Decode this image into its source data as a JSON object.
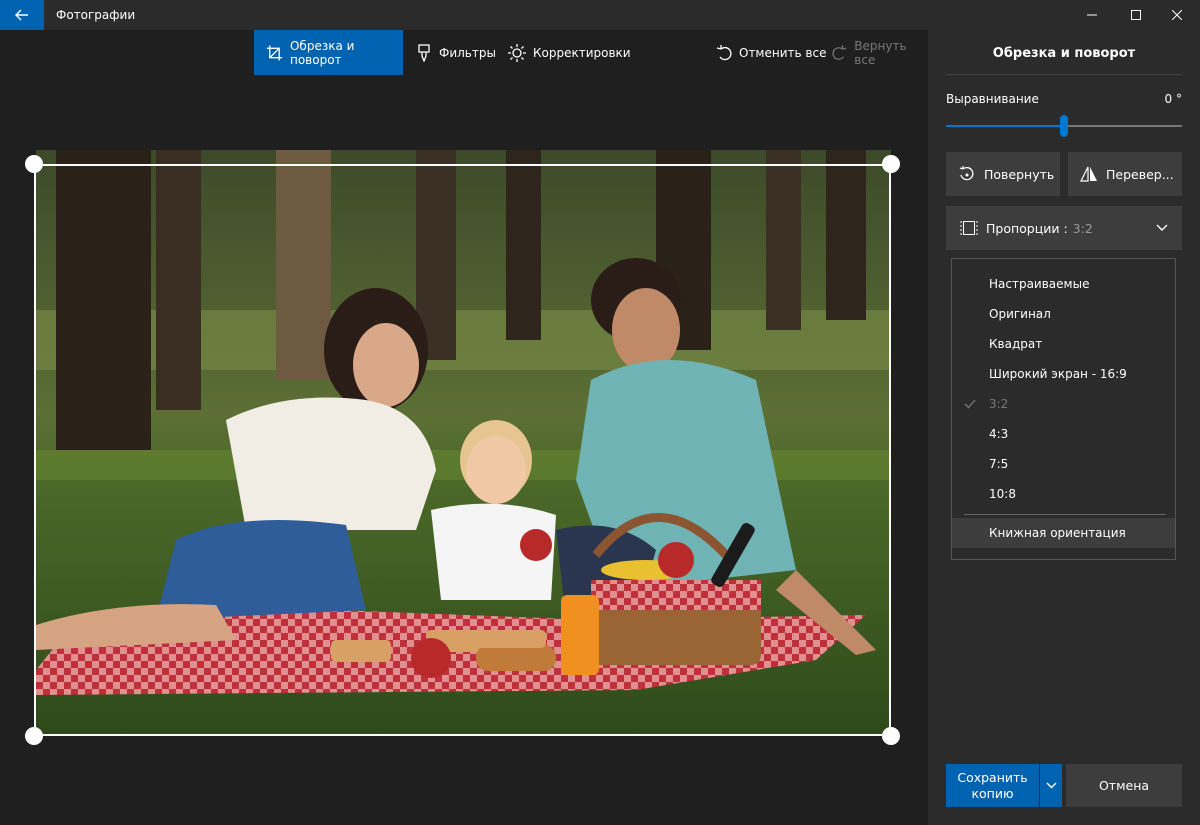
{
  "app": {
    "title": "Фотографии"
  },
  "toolbar": {
    "crop": "Обрезка и поворот",
    "filters": "Фильтры",
    "adjust": "Корректировки",
    "undo_all": "Отменить все",
    "redo_all": "Вернуть все"
  },
  "panel": {
    "title": "Обрезка и поворот",
    "straighten_label": "Выравнивание",
    "straighten_value": "0 °",
    "straighten_level": 0.5,
    "rotate": "Повернуть",
    "flip": "Перевер...",
    "aspect_label": "Пропорции :",
    "aspect_value": "3:2"
  },
  "aspect_menu": {
    "items": [
      {
        "label": "Настраиваемые"
      },
      {
        "label": "Оригинал"
      },
      {
        "label": "Квадрат"
      },
      {
        "label": "Широкий экран - 16:9"
      },
      {
        "label": "3:2",
        "selected": true
      },
      {
        "label": "4:3"
      },
      {
        "label": "7:5"
      },
      {
        "label": "10:8"
      }
    ],
    "portrait": "Книжная ориентация"
  },
  "actions": {
    "save_line1": "Сохранить",
    "save_line2": "копию",
    "cancel": "Отмена"
  },
  "colors": {
    "accent": "#0063b1",
    "panel": "#2b2b2b",
    "canvas": "#1f1f1f"
  }
}
